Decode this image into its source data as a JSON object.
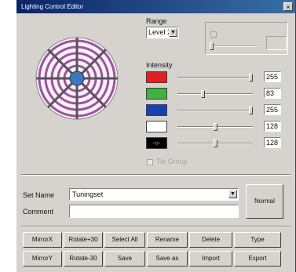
{
  "window": {
    "title": "Lighting Control Editor",
    "close_glyph": "×"
  },
  "range": {
    "label": "Range",
    "selected": "Level 2",
    "arrow": "▼",
    "disabled_box_label": "",
    "disabled_check_label": ""
  },
  "intensity": {
    "label": "Intensity",
    "channels": [
      {
        "swatch_color": "#e02020",
        "swatch_text": "",
        "value": "255",
        "level": 1.0
      },
      {
        "swatch_color": "#40b040",
        "swatch_text": "",
        "value": "83",
        "level": 0.33
      },
      {
        "swatch_color": "#1a3fb0",
        "swatch_text": "",
        "value": "255",
        "level": 1.0
      },
      {
        "swatch_color": "#ffffff",
        "swatch_text": "",
        "value": "128",
        "level": 0.5
      },
      {
        "swatch_color": "#000000",
        "swatch_text": "·○·",
        "value": "128",
        "level": 0.5
      }
    ],
    "checkbox_label": "Tie Group"
  },
  "form": {
    "setname_label": "Set Name",
    "setname_value": "Tuningset",
    "comment_label": "Comment",
    "comment_value": "",
    "normal_button": "Normal"
  },
  "buttons_row1": [
    "MirrorX",
    "Rotate+30",
    "Select All",
    "Rename",
    "Delete",
    "Type"
  ],
  "buttons_row2": [
    "MirrorY",
    "Rotate-30",
    "Save",
    "Save as",
    "Import",
    "Export"
  ]
}
